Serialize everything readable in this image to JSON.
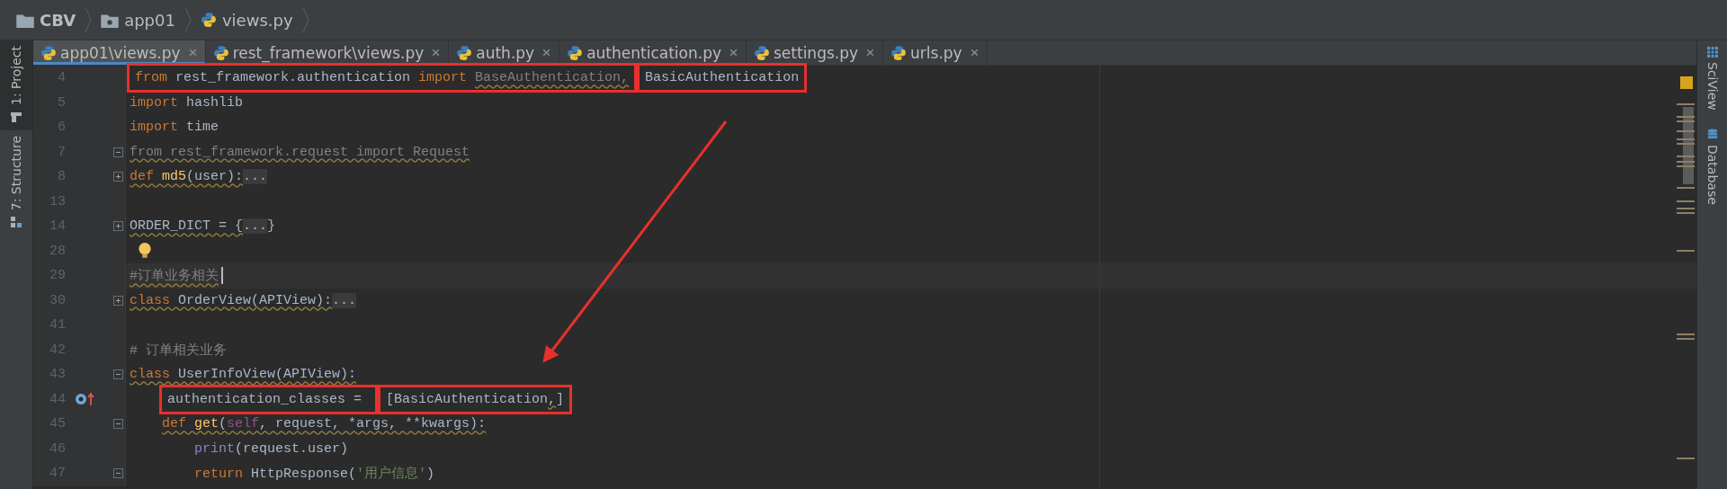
{
  "breadcrumbs": [
    {
      "label": "CBV",
      "kind": "folder"
    },
    {
      "label": "app01",
      "kind": "package"
    },
    {
      "label": "views.py",
      "kind": "python"
    }
  ],
  "tabs": [
    {
      "label": "app01\\views.py",
      "selected": true
    },
    {
      "label": "rest_framework\\views.py",
      "selected": false
    },
    {
      "label": "auth.py",
      "selected": false
    },
    {
      "label": "authentication.py",
      "selected": false
    },
    {
      "label": "settings.py",
      "selected": false
    },
    {
      "label": "urls.py",
      "selected": false
    }
  ],
  "left_tool_windows": [
    {
      "label": "1: Project",
      "kind": "project",
      "selected": true
    },
    {
      "label": "7: Structure",
      "kind": "structure",
      "selected": false
    }
  ],
  "right_tool_windows": [
    {
      "label": "SciView",
      "kind": "sciview"
    },
    {
      "label": "Database",
      "kind": "database"
    }
  ],
  "editor": {
    "lines": [
      {
        "number": "4",
        "current": false,
        "segments": [
          {
            "boxed": true,
            "tokens": [
              {
                "text": "from",
                "kind": "keyword",
                "warn": false
              },
              {
                "text": " rest_framework.authentication ",
                "kind": "plain",
                "warn": false
              },
              {
                "text": "import ",
                "kind": "keyword",
                "warn": false
              },
              {
                "text": "BaseAuthentication,",
                "kind": "unused",
                "warn": true
              }
            ]
          },
          {
            "boxed": true,
            "tokens": [
              {
                "text": "BasicAuthentication",
                "kind": "plain",
                "warn": false
              }
            ]
          }
        ]
      },
      {
        "number": "5",
        "current": false,
        "segments": [
          {
            "boxed": false,
            "tokens": [
              {
                "text": "import",
                "kind": "keyword",
                "warn": false
              },
              {
                "text": " hashlib",
                "kind": "plain",
                "warn": false
              }
            ]
          }
        ]
      },
      {
        "number": "6",
        "current": false,
        "segments": [
          {
            "boxed": false,
            "tokens": [
              {
                "text": "import",
                "kind": "keyword",
                "warn": false
              },
              {
                "text": " time",
                "kind": "plain",
                "warn": false
              }
            ]
          }
        ]
      },
      {
        "number": "7",
        "current": false,
        "fold": {
          "expanded": true
        },
        "segments": [
          {
            "boxed": false,
            "tokens": [
              {
                "text": "from rest_framework.request import Request",
                "kind": "unused",
                "warn": true
              }
            ]
          }
        ]
      },
      {
        "number": "8",
        "current": false,
        "fold": {
          "expanded": false
        },
        "segments": [
          {
            "boxed": false,
            "tokens": [
              {
                "text": "def ",
                "kind": "keyword",
                "warn": true
              },
              {
                "text": "md5",
                "kind": "func",
                "warn": true
              },
              {
                "text": "(user):",
                "kind": "plain",
                "warn": true
              },
              {
                "text": "...",
                "kind": "folded",
                "warn": false
              }
            ]
          }
        ]
      },
      {
        "number": "13",
        "current": false
      },
      {
        "number": "14",
        "current": false,
        "fold": {
          "expanded": false
        },
        "segments": [
          {
            "boxed": false,
            "tokens": [
              {
                "text": "ORDER_DICT = {",
                "kind": "plain",
                "warn": true
              },
              {
                "text": "...",
                "kind": "folded",
                "warn": false
              },
              {
                "text": "}",
                "kind": "plain",
                "warn": false
              }
            ]
          }
        ]
      },
      {
        "number": "28",
        "current": false,
        "intention_bulb": true
      },
      {
        "number": "29",
        "current": true,
        "segments": [
          {
            "boxed": false,
            "tokens": [
              {
                "text": "#订单业务相关",
                "kind": "comment",
                "warn": true
              }
            ]
          }
        ]
      },
      {
        "number": "30",
        "current": false,
        "fold": {
          "expanded": false
        },
        "segments": [
          {
            "boxed": false,
            "tokens": [
              {
                "text": "class",
                "kind": "keyword",
                "warn": true
              },
              {
                "text": " OrderView(APIView):",
                "kind": "plain",
                "warn": true
              },
              {
                "text": "...",
                "kind": "folded",
                "warn": false
              }
            ]
          }
        ]
      },
      {
        "number": "41",
        "current": false
      },
      {
        "number": "42",
        "current": false,
        "segments": [
          {
            "boxed": false,
            "tokens": [
              {
                "text": "# 订单相关业务",
                "kind": "comment",
                "warn": false
              }
            ]
          }
        ]
      },
      {
        "number": "43",
        "current": false,
        "fold": {
          "expanded": true
        },
        "segments": [
          {
            "boxed": false,
            "tokens": [
              {
                "text": "class",
                "kind": "keyword",
                "warn": true
              },
              {
                "text": " UserInfoView(APIView):",
                "kind": "plain",
                "warn": true
              }
            ]
          }
        ],
        "children": [
          {
            "number": "44",
            "current": false,
            "override_marker": true,
            "segments": [
              {
                "boxed": true,
                "tokens": [
                  {
                    "text": "authentication_classes = ",
                    "kind": "plain",
                    "warn": false
                  }
                ]
              },
              {
                "boxed": true,
                "tokens": [
                  {
                    "text": "[BasicAuthentication",
                    "kind": "plain",
                    "warn": false
                  },
                  {
                    "text": ",",
                    "kind": "plain",
                    "warn": true
                  },
                  {
                    "text": "]",
                    "kind": "plain",
                    "warn": false
                  }
                ]
              }
            ]
          },
          {
            "number": "45",
            "current": false,
            "fold": {
              "expanded": true
            },
            "segments": [
              {
                "boxed": false,
                "tokens": [
                  {
                    "text": "def ",
                    "kind": "keyword",
                    "warn": true
                  },
                  {
                    "text": "get",
                    "kind": "func",
                    "warn": true
                  },
                  {
                    "text": "(",
                    "kind": "plain",
                    "warn": true
                  },
                  {
                    "text": "self",
                    "kind": "self",
                    "warn": true
                  },
                  {
                    "text": ", request, *args, **kwargs):",
                    "kind": "plain",
                    "warn": true
                  }
                ]
              }
            ],
            "children": [
              {
                "number": "46",
                "current": false,
                "segments": [
                  {
                    "boxed": false,
                    "tokens": [
                      {
                        "text": "print",
                        "kind": "builtin",
                        "warn": false
                      },
                      {
                        "text": "(request.user)",
                        "kind": "plain",
                        "warn": false
                      }
                    ]
                  }
                ]
              },
              {
                "number": "47",
                "current": false,
                "fold": {
                  "expanded": true
                },
                "segments": [
                  {
                    "boxed": false,
                    "tokens": [
                      {
                        "text": "return",
                        "kind": "keyword",
                        "warn": false
                      },
                      {
                        "text": " HttpResponse(",
                        "kind": "plain",
                        "warn": false
                      },
                      {
                        "text": "'用户信息'",
                        "kind": "string",
                        "warn": false
                      },
                      {
                        "text": ")",
                        "kind": "plain",
                        "warn": false
                      }
                    ]
                  }
                ]
              }
            ]
          }
        ]
      }
    ]
  }
}
